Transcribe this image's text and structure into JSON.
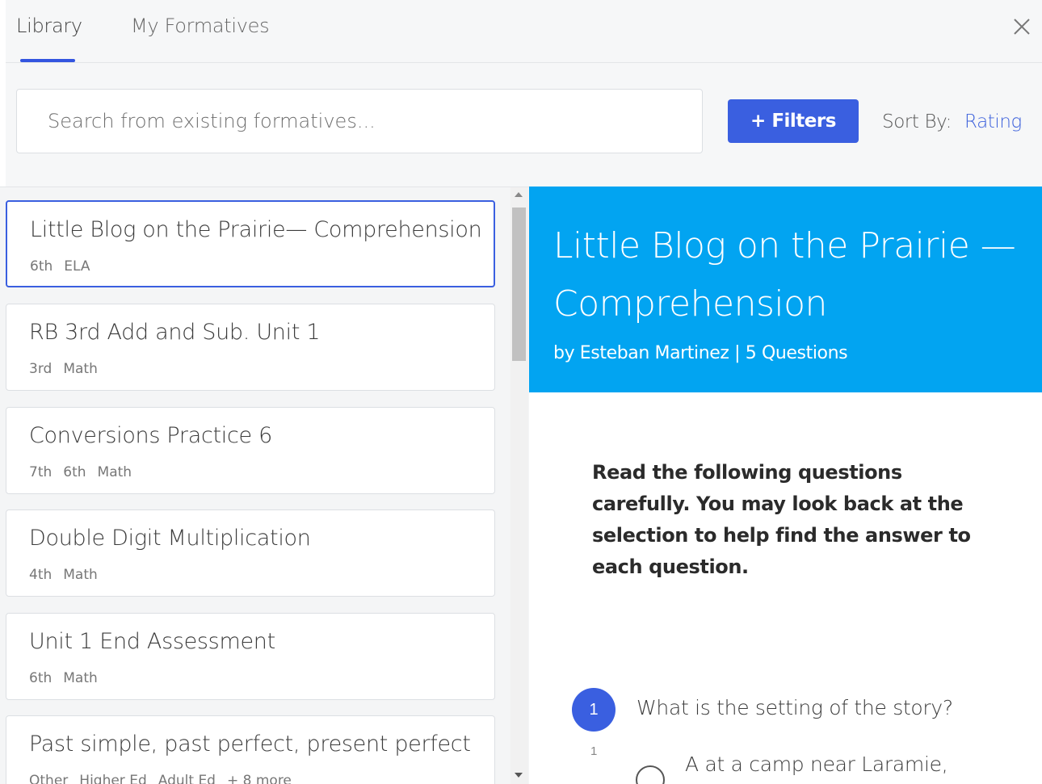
{
  "tabs": {
    "library": "Library",
    "my_formatives": "My Formatives"
  },
  "search": {
    "placeholder": "Search from existing formatives...",
    "value": ""
  },
  "filters_button": "+ Filters",
  "sort": {
    "label": "Sort By:",
    "value": "Rating"
  },
  "formatives": [
    {
      "title": "Little Blog on the Prairie— Comprehension",
      "tags": [
        "6th",
        "ELA"
      ],
      "selected": true
    },
    {
      "title": "RB 3rd Add and Sub. Unit 1",
      "tags": [
        "3rd",
        "Math"
      ]
    },
    {
      "title": "Conversions Practice 6",
      "tags": [
        "7th",
        "6th",
        "Math"
      ]
    },
    {
      "title": "Double Digit Multiplication",
      "tags": [
        "4th",
        "Math"
      ]
    },
    {
      "title": "Unit 1 End Assessment",
      "tags": [
        "6th",
        "Math"
      ]
    },
    {
      "title": "Past simple, past perfect, present perfect",
      "tags": [
        "Other",
        "Higher Ed",
        "Adult Ed",
        "+ 8 more"
      ]
    }
  ],
  "preview": {
    "title": "Little Blog on the Prairie — Comprehension",
    "meta": "by Esteban Martinez | 5 Questions",
    "instructions": "Read the following questions carefully. You may look back at the selection to help find the answer to each question.",
    "question": {
      "number": "1",
      "text": "What is the setting of the story?",
      "points": "1",
      "option_a": "A  at a camp near Laramie,"
    }
  },
  "colors": {
    "accent": "#3a5fe0",
    "header_blue": "#02a4f1",
    "link": "#3f63dc"
  }
}
